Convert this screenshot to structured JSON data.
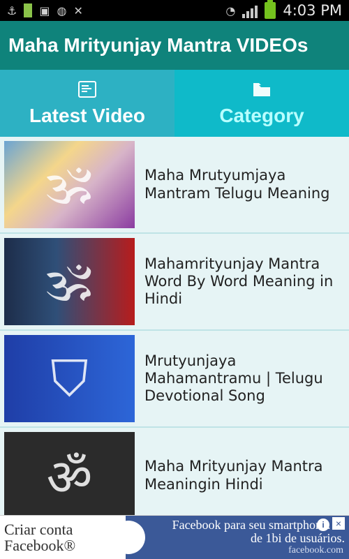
{
  "status_bar": {
    "time": "4:03 PM",
    "left_icons": [
      "usb-icon",
      "battery-small-icon",
      "sd-card-icon",
      "app-icon",
      "sync-icon"
    ],
    "right_icons": [
      "wifi-icon",
      "signal-icon",
      "battery-icon"
    ]
  },
  "app": {
    "title": "Maha Mrityunjay Mantra VIDEOs"
  },
  "tabs": [
    {
      "label": "Latest Video",
      "icon": "list-icon"
    },
    {
      "label": "Category",
      "icon": "folder-icon"
    }
  ],
  "videos": [
    {
      "title": "Maha Mrutyumjaya Mantram Telugu Meaning",
      "thumb": "video-thumbnail"
    },
    {
      "title": "Mahamrityunjay Mantra Word By Word Meaning in Hindi",
      "thumb": "video-thumbnail"
    },
    {
      "title": "Mrutyunjaya Mahamantramu | Telugu Devotional Song",
      "thumb": "video-thumbnail"
    },
    {
      "title": "Maha Mrityunjay Mantra Meaningin Hindi",
      "thumb": "video-thumbnail"
    }
  ],
  "ad": {
    "left_text_line1": "Criar conta",
    "left_text_line2": "Facebook®",
    "right_text_line1": "Facebook para seu smartphone. M",
    "right_text_line2": "de 1bi de usuários.",
    "source": "facebook.com"
  },
  "colors": {
    "appbar": "#0f837b",
    "tab_active": "#2db1c3",
    "tab_inactive": "#0fbac9",
    "list_bg": "#e6f4f5",
    "facebook": "#3b5998"
  }
}
